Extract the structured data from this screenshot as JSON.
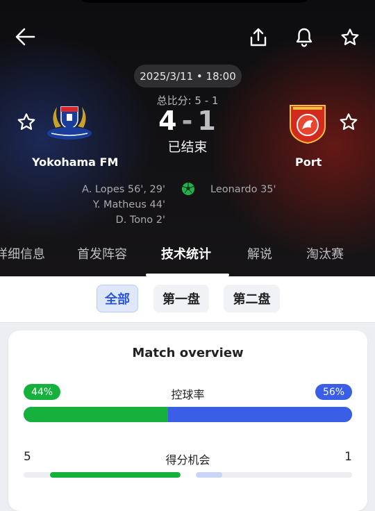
{
  "match": {
    "date": "2025/3/11 • 18:00",
    "aggregate": "总比分: 5 - 1",
    "home_score": "4",
    "score_separator": "-",
    "away_score": "1",
    "status": "已结束"
  },
  "home": {
    "name": "Yokohama FM",
    "scorers": [
      "A. Lopes 56', 29'",
      "Y. Matheus 44'",
      "D. Tono 2'"
    ],
    "color": "#16b03c"
  },
  "away": {
    "name": "Port",
    "scorers": [
      "Leonardo 35'"
    ],
    "color": "#3b5ee6"
  },
  "tabs": [
    {
      "label": "详细信息",
      "active": false
    },
    {
      "label": "首发阵容",
      "active": false
    },
    {
      "label": "技术统计",
      "active": true
    },
    {
      "label": "解说",
      "active": false
    },
    {
      "label": "淘汰赛",
      "active": false
    }
  ],
  "periods": [
    {
      "label": "全部",
      "active": true
    },
    {
      "label": "第一盘",
      "active": false
    },
    {
      "label": "第二盘",
      "active": false
    }
  ],
  "overview": {
    "title": "Match overview",
    "possession": {
      "label": "控球率",
      "home_pct": "44%",
      "away_pct": "56%",
      "home_value": 44,
      "away_value": 56
    },
    "chances": {
      "label": "得分机会",
      "home": "5",
      "away": "1",
      "home_fill": 0.83,
      "away_fill": 0.17
    }
  },
  "icons": {
    "back": "back-arrow-icon",
    "share": "share-icon",
    "notify": "bell-icon",
    "favorite": "star-icon",
    "goal": "soccer-ball-icon"
  }
}
